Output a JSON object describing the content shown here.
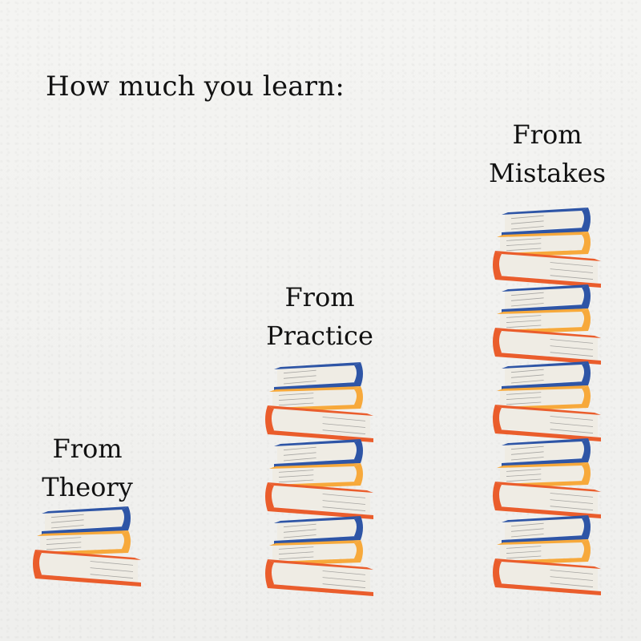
{
  "heading": "How much you learn:",
  "columns": [
    {
      "line1": "From",
      "line2": "Theory",
      "stacks": 1
    },
    {
      "line1": "From",
      "line2": "Practice",
      "stacks": 3
    },
    {
      "line1": "From",
      "line2": "Mistakes",
      "stacks": 5
    }
  ],
  "colors": {
    "blue": "#2e55a6",
    "yellow": "#f7a93b",
    "orange": "#ea5d2c",
    "pages": "#efece4",
    "background": "#f2f2f0"
  },
  "icon": "book-stack-icon"
}
